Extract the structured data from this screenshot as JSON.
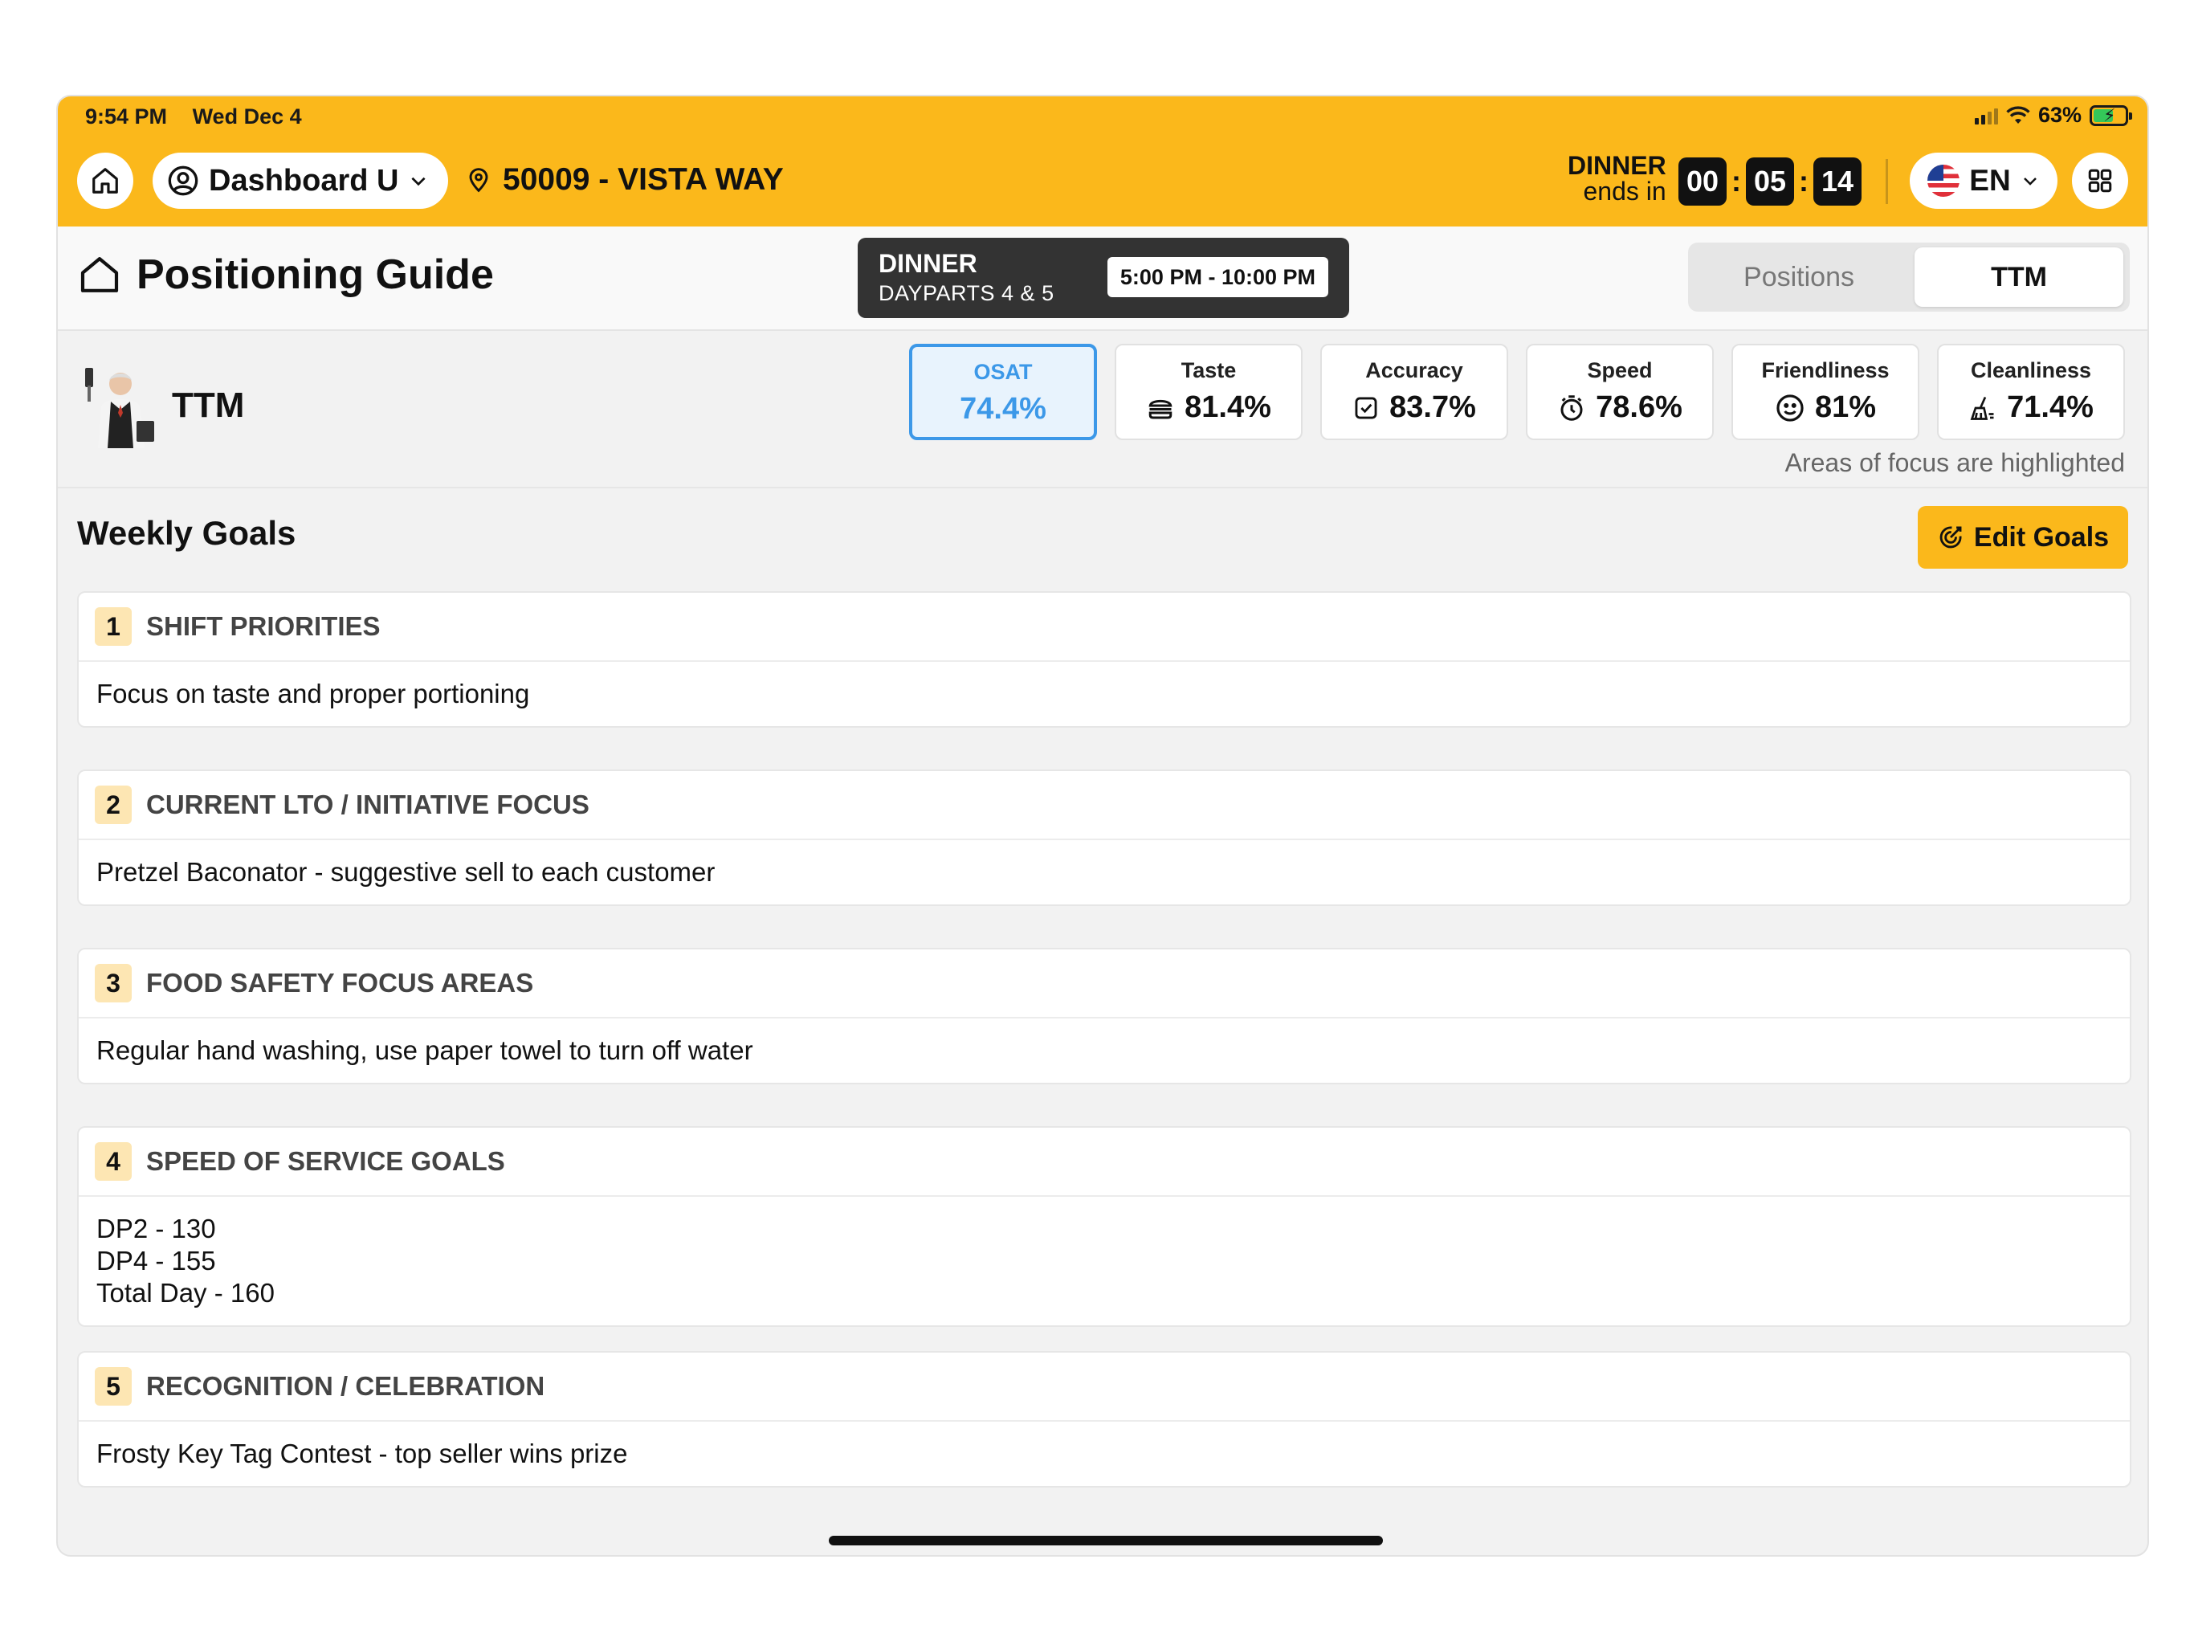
{
  "status_bar": {
    "time": "9:54 PM",
    "date": "Wed Dec 4",
    "battery": "63%",
    "battery_level": 0.63
  },
  "topbar": {
    "dashboard_label": "Dashboard U",
    "store": "50009 - VISTA WAY",
    "daypart_name": "DINNER",
    "ends_in": "ends in",
    "timer": {
      "hours": "00",
      "minutes": "05",
      "seconds": "14"
    },
    "language": "EN"
  },
  "header": {
    "title": "Positioning Guide",
    "daypart": {
      "name": "DINNER",
      "sub": "DAYPARTS 4 & 5",
      "time": "5:00 PM - 10:00 PM"
    },
    "tabs": [
      {
        "label": "Positions",
        "active": false
      },
      {
        "label": "TTM",
        "active": true
      }
    ]
  },
  "metrics": {
    "role": "TTM",
    "cards": [
      {
        "label": "OSAT",
        "value": "74.4%",
        "icon": "none"
      },
      {
        "label": "Taste",
        "value": "81.4%",
        "icon": "burger-icon"
      },
      {
        "label": "Accuracy",
        "value": "83.7%",
        "icon": "checkbox-icon"
      },
      {
        "label": "Speed",
        "value": "78.6%",
        "icon": "stopwatch-icon"
      },
      {
        "label": "Friendliness",
        "value": "81%",
        "icon": "smiley-icon"
      },
      {
        "label": "Cleanliness",
        "value": "71.4%",
        "icon": "broom-icon"
      }
    ],
    "note": "Areas of focus are highlighted"
  },
  "goals": {
    "title": "Weekly Goals",
    "edit_label": "Edit Goals",
    "items": [
      {
        "num": "1",
        "title": "SHIFT PRIORITIES",
        "body": "Focus on taste and proper portioning"
      },
      {
        "num": "2",
        "title": "CURRENT LTO / INITIATIVE FOCUS",
        "body": "Pretzel Baconator - suggestive sell to each customer"
      },
      {
        "num": "3",
        "title": "FOOD SAFETY FOCUS AREAS",
        "body": "Regular hand washing, use paper towel to turn off water"
      },
      {
        "num": "4",
        "title": "SPEED OF SERVICE GOALS",
        "body": "DP2 - 130\nDP4 - 155\nTotal Day - 160"
      },
      {
        "num": "5",
        "title": "RECOGNITION / CELEBRATION",
        "body": "Frosty Key Tag Contest - top seller wins prize"
      }
    ]
  },
  "colors": {
    "brand_yellow": "#fbb81b",
    "osat_blue": "#3c98e8",
    "dark": "#333333",
    "number_badge": "#fde6b3"
  }
}
